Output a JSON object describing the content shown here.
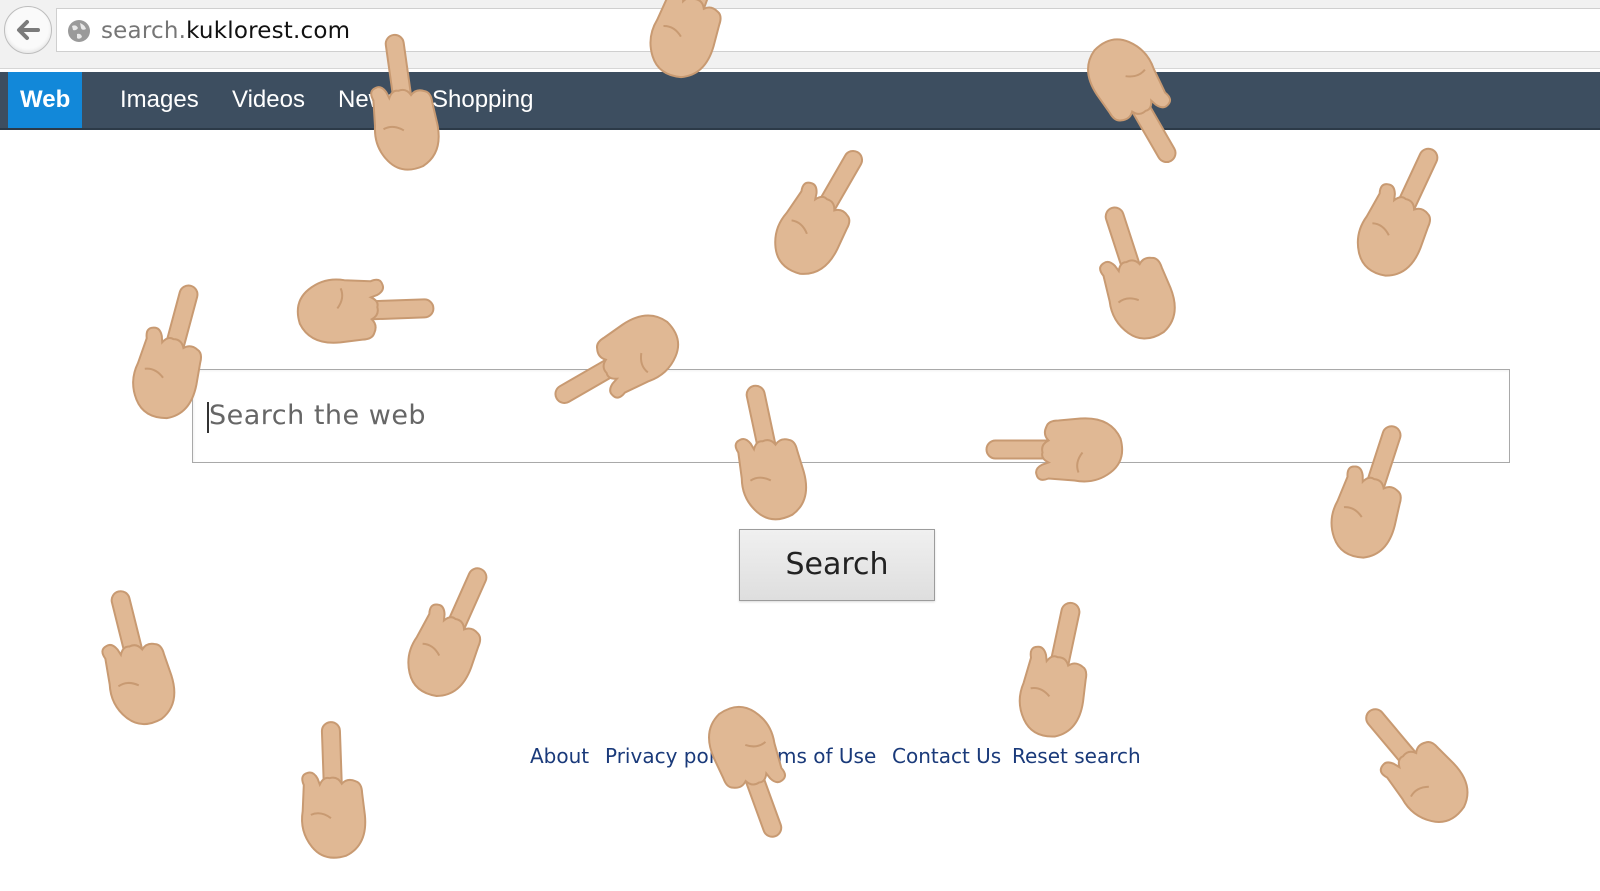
{
  "browser": {
    "url_scheme": "search.",
    "url_host": "kuklorest.com"
  },
  "nav": {
    "tabs": [
      {
        "label": "Web",
        "active": true
      },
      {
        "label": "Images",
        "active": false
      },
      {
        "label": "Videos",
        "active": false
      },
      {
        "label": "News",
        "active": false
      },
      {
        "label": "Shopping",
        "active": false
      }
    ]
  },
  "search": {
    "placeholder": "Search the web",
    "button_label": "Search"
  },
  "footer": {
    "links": [
      "About",
      "Privacy policy",
      "Terms of Use",
      "Contact Us",
      "Reset search"
    ]
  },
  "colors": {
    "nav_bg": "#3d4e60",
    "nav_active": "#1288d9",
    "link": "#1a3a7a",
    "hand_skin": "#e0b894"
  },
  "overlay": {
    "hand_icon": "middle-finger-hand-icon"
  }
}
